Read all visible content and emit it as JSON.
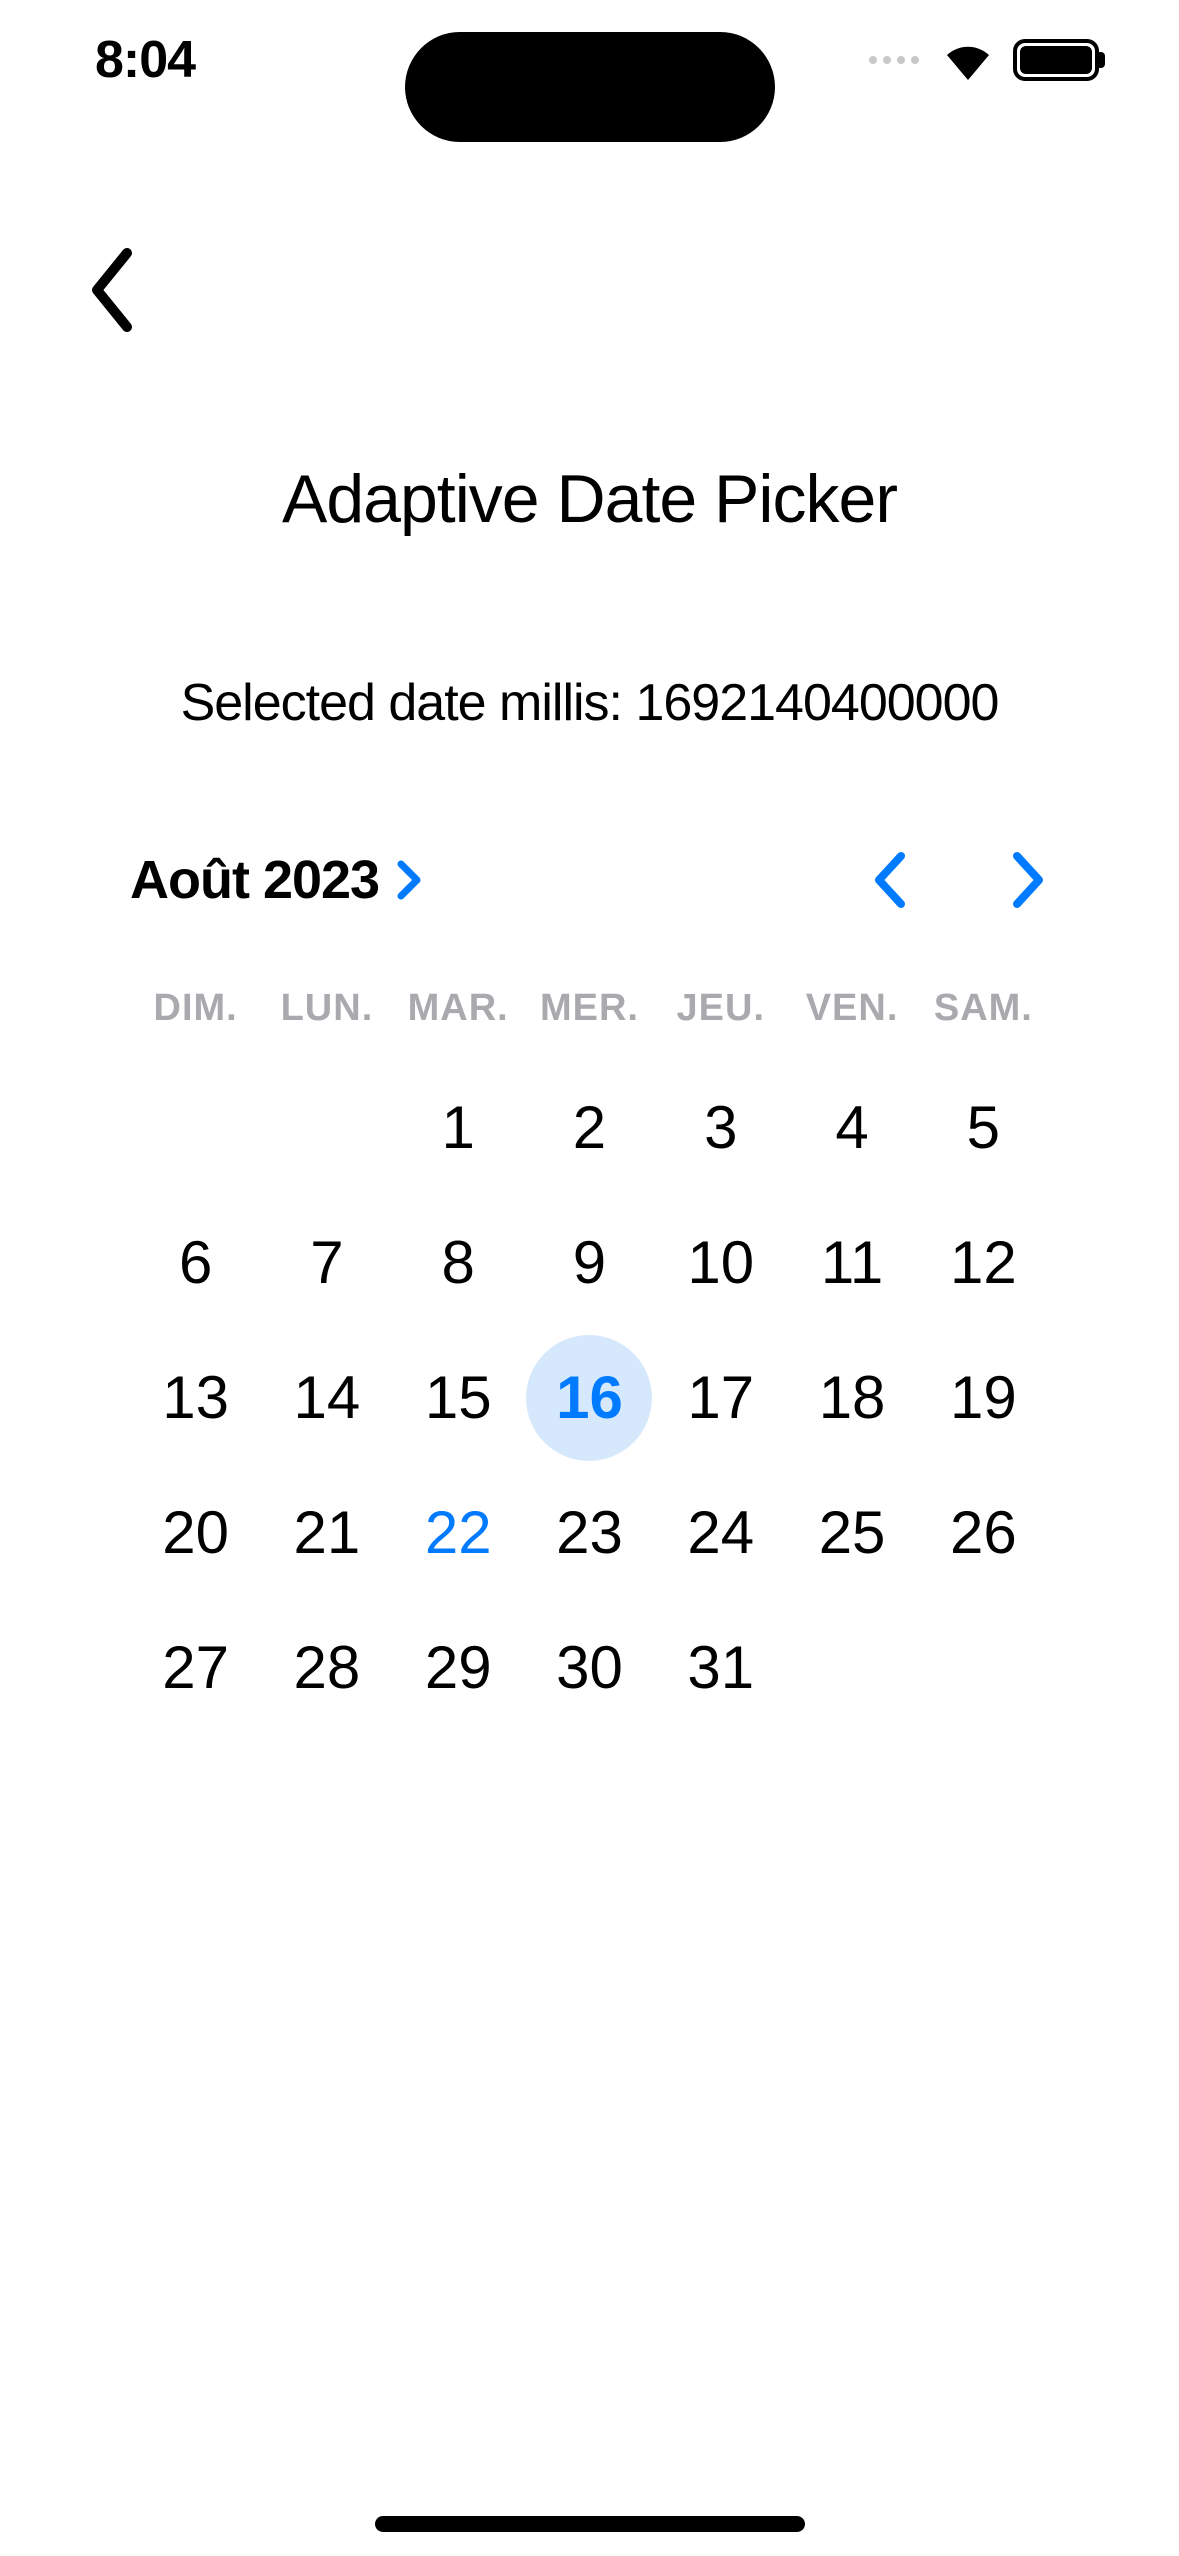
{
  "status": {
    "time": "8:04"
  },
  "title": "Adaptive Date Picker",
  "selected_label": "Selected date millis: ",
  "selected_millis": "1692140400000",
  "calendar": {
    "month_year": "Août 2023",
    "accent_color": "#007aff",
    "weekdays": [
      "DIM.",
      "LUN.",
      "MAR.",
      "MER.",
      "JEU.",
      "VEN.",
      "SAM."
    ],
    "first_weekday_index": 2,
    "days_in_month": 31,
    "selected_day": 16,
    "today_day": 22
  }
}
